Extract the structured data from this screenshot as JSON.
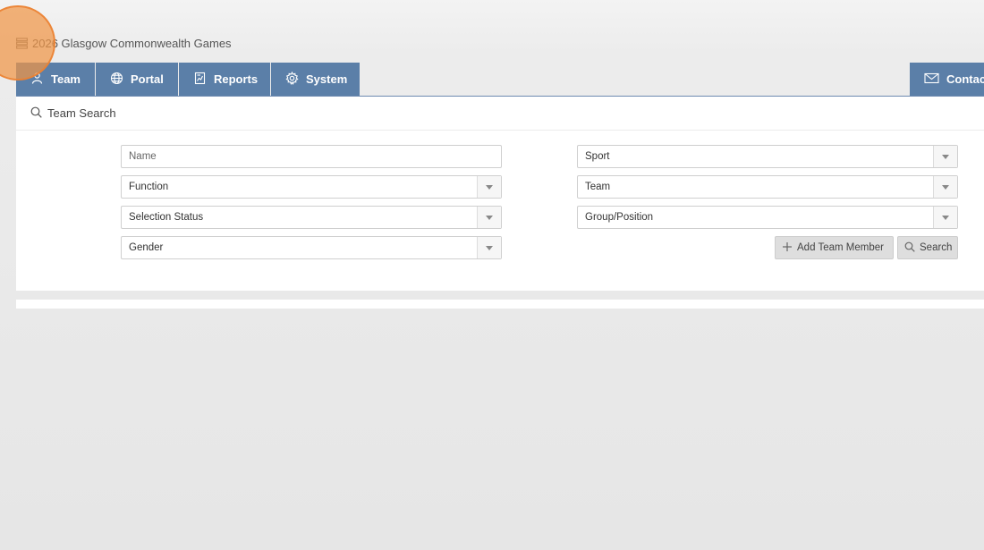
{
  "app": {
    "title": "2026 Glasgow Commonwealth Games"
  },
  "nav": {
    "tabs": [
      {
        "label": "Team",
        "icon": "team-icon"
      },
      {
        "label": "Portal",
        "icon": "globe-icon"
      },
      {
        "label": "Reports",
        "icon": "report-icon"
      },
      {
        "label": "System",
        "icon": "gear-icon"
      }
    ],
    "contact": {
      "label": "Contact",
      "icon": "envelope-icon"
    }
  },
  "search_panel": {
    "title": "Team Search",
    "fields": {
      "name": {
        "value": "",
        "placeholder": "Name"
      },
      "function": "Function",
      "selection_status": "Selection Status",
      "gender": "Gender",
      "sport": "Sport",
      "team": "Team",
      "group_position": "Group/Position"
    },
    "buttons": {
      "add_member": "Add Team Member",
      "search": "Search"
    }
  },
  "colors": {
    "nav_tab": "#5b7fa8",
    "cursor_highlight": "#f0964a"
  }
}
